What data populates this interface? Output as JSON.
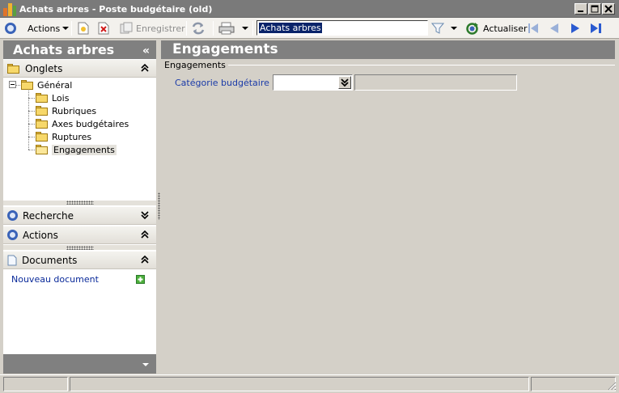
{
  "window": {
    "title": "Achats arbres -  Poste budgétaire (old)"
  },
  "toolbar": {
    "actions_label": "Actions",
    "save_label": "Enregistrer",
    "search_value": "Achats arbres",
    "refresh_label": "Actualiser"
  },
  "left_panel": {
    "title": "Achats arbres",
    "tabs_header": "Onglets",
    "tree": {
      "root": "Général",
      "children": [
        "Lois",
        "Rubriques",
        "Axes budgétaires",
        "Ruptures",
        "Engagements"
      ],
      "selected": "Engagements"
    },
    "search_header": "Recherche",
    "actions_header": "Actions",
    "documents_header": "Documents",
    "new_document_link": "Nouveau document"
  },
  "main": {
    "title": "Engagements",
    "group_title": "Engagements",
    "budget_category_label": "Catégorie budgétaire :",
    "budget_category_value": "",
    "budget_category_desc": ""
  },
  "colors": {
    "title_bar": "#7a7a7a",
    "panel_header": "#808080",
    "link_blue": "#0a2a9a",
    "selection": "#0a246a"
  }
}
